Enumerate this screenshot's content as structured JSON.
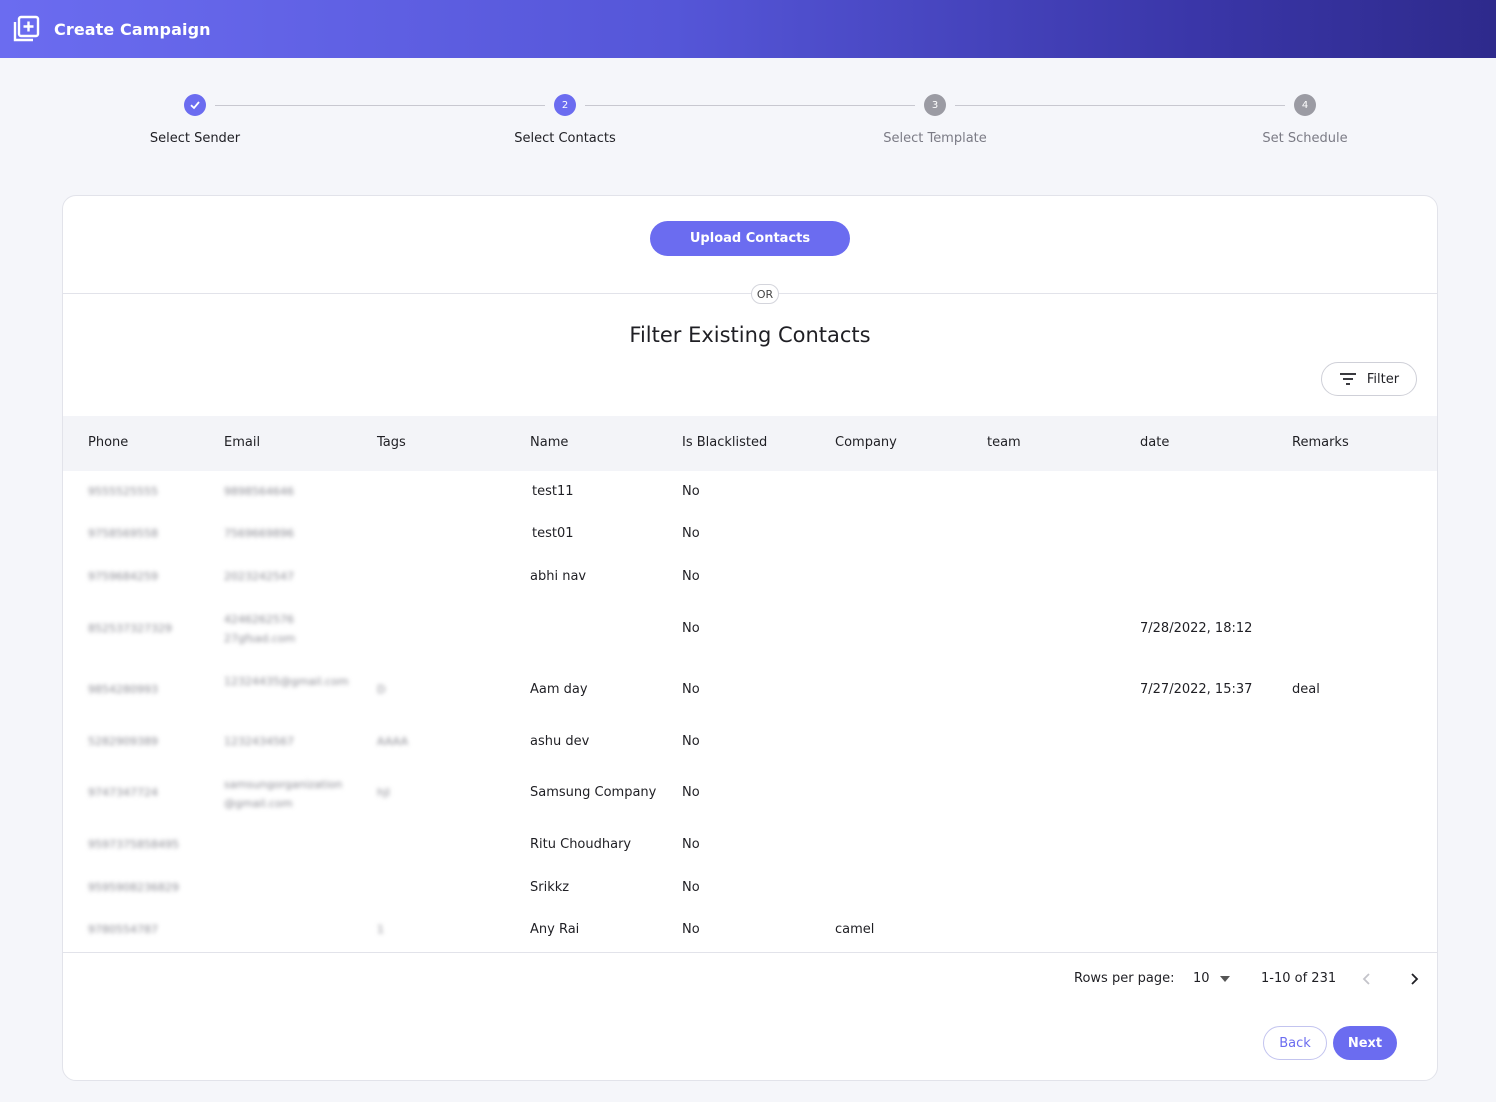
{
  "header": {
    "title": "Create Campaign",
    "logo_icon": "add-box-icon"
  },
  "stepper": {
    "steps": [
      {
        "number": "",
        "label": "Select Sender",
        "state": "done"
      },
      {
        "number": "2",
        "label": "Select Contacts",
        "state": "active"
      },
      {
        "number": "3",
        "label": "Select Template",
        "state": "todo"
      },
      {
        "number": "4",
        "label": "Set Schedule",
        "state": "todo"
      }
    ]
  },
  "upload": {
    "label": "Upload Contacts"
  },
  "divider": {
    "label": "OR"
  },
  "section": {
    "title": "Filter Existing Contacts",
    "filter_label": "Filter"
  },
  "table": {
    "columns": [
      "Phone",
      "Email",
      "Tags",
      "Name",
      "Is Blacklisted",
      "Company",
      "team",
      "date",
      "Remarks"
    ],
    "rows": [
      {
        "phone": "9555525555",
        "email": "9898564646",
        "tags": "",
        "name": "test11",
        "blacklisted": "No",
        "company": "",
        "team": "",
        "date": "",
        "remarks": ""
      },
      {
        "phone": "9758569558",
        "email": "7569669896",
        "tags": "",
        "name": "test01",
        "blacklisted": "No",
        "company": "",
        "team": "",
        "date": "",
        "remarks": ""
      },
      {
        "phone": "9759684259",
        "email": "2023242547",
        "tags": "",
        "name": "abhi nav",
        "blacklisted": "No",
        "company": "",
        "team": "",
        "date": "",
        "remarks": ""
      },
      {
        "phone": "852537327329",
        "email": "4246262576 27gfsad.com",
        "tags": "",
        "name": "",
        "blacklisted": "No",
        "company": "",
        "team": "",
        "date": "7/28/2022, 18:12",
        "remarks": ""
      },
      {
        "phone": "9854280993",
        "email": "12324435@gmail.com",
        "tags": "D",
        "name": "Aam day",
        "blacklisted": "No",
        "company": "",
        "team": "",
        "date": "7/27/2022, 15:37",
        "remarks": "deal"
      },
      {
        "phone": "5282909389",
        "email": "1232434567",
        "tags": "AAAA",
        "name": "ashu dev",
        "blacklisted": "No",
        "company": "",
        "team": "",
        "date": "",
        "remarks": ""
      },
      {
        "phone": "9747347724",
        "email": "samsungorganization @gmail.com",
        "tags": "hjl",
        "name": "Samsung Company",
        "blacklisted": "No",
        "company": "",
        "team": "",
        "date": "",
        "remarks": ""
      },
      {
        "phone": "9597375858495",
        "email": "",
        "tags": "",
        "name": "Ritu Choudhary",
        "blacklisted": "No",
        "company": "",
        "team": "",
        "date": "",
        "remarks": ""
      },
      {
        "phone": "9595908236829",
        "email": "",
        "tags": "",
        "name": "Srikkz",
        "blacklisted": "No",
        "company": "",
        "team": "",
        "date": "",
        "remarks": ""
      },
      {
        "phone": "9780554787",
        "email": "",
        "tags": "1",
        "name": "Any Rai",
        "blacklisted": "No",
        "company": "camel",
        "team": "",
        "date": "",
        "remarks": ""
      }
    ]
  },
  "pagination": {
    "rows_label": "Rows per page:",
    "rows_value": "10",
    "range": "1-10 of 231"
  },
  "actions": {
    "back_label": "Back",
    "next_label": "Next"
  },
  "colors": {
    "accent": "#6b6cf0",
    "header_dark": "#2e2a8c"
  }
}
